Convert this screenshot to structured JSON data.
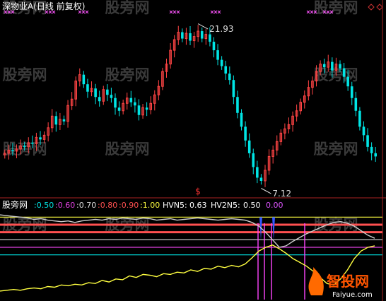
{
  "header": {
    "stock": "深物业A(日线 前复权)",
    "high_label": "21.93",
    "low_label": "7.12",
    "signal_mark": "$"
  },
  "watermarks": [
    "股旁网",
    "股旁网",
    "股旁网",
    "股旁网",
    "股旁网",
    "股旁网",
    "股旁网",
    "股旁网",
    "股旁网",
    "股旁网",
    "股旁网",
    "股旁网"
  ],
  "indicator": {
    "name": "股旁网",
    "levels": [
      {
        "text": "0.50",
        "color": "#00e5e5"
      },
      {
        "text": "0.60",
        "color": "#e040e0"
      },
      {
        "text": "0.70",
        "color": "#dddddd"
      },
      {
        "text": "0.80",
        "color": "#ff5050"
      },
      {
        "text": "0.90",
        "color": "#ff5050"
      },
      {
        "text": "1.00",
        "color": "#ffff40"
      }
    ],
    "hvn5_label": "HVN5:",
    "hvn5_value": "0.63",
    "hv2n5_label": "HV2N5:",
    "hv2n5_value": "0.50",
    "extra_value": "0.00"
  },
  "logo": {
    "text": "智投网",
    "url": "Faiyue.com"
  },
  "chart_data": [
    {
      "type": "candlestick",
      "title": "深物业A(日线 前复权)",
      "y_range": [
        6.5,
        23
      ],
      "annotations": [
        {
          "label": "21.93",
          "kind": "high"
        },
        {
          "label": "7.12",
          "kind": "low"
        }
      ],
      "close_path": [
        9.9,
        10.2,
        10.1,
        10.3,
        10.6,
        10.5,
        10.9,
        10.8,
        11.4,
        11.2,
        11.6,
        12.3,
        13.4,
        12.6,
        13.1,
        12.9,
        14.4,
        15.0,
        16.7,
        17.3,
        16.4,
        15.7,
        16.0,
        15.2,
        14.8,
        15.9,
        15.4,
        15.1,
        14.2,
        13.9,
        14.6,
        15.1,
        14.7,
        14.4,
        13.5,
        14.2,
        14.0,
        14.6,
        15.4,
        16.2,
        17.6,
        18.3,
        19.6,
        20.6,
        21.3,
        20.7,
        21.2,
        20.5,
        20.9,
        21.4,
        20.7,
        21.1,
        20.4,
        19.6,
        18.7,
        18.1,
        17.4,
        16.8,
        15.2,
        13.7,
        12.4,
        11.1,
        9.9,
        8.6,
        7.6,
        7.3,
        8.3,
        9.6,
        10.2,
        11.0,
        11.8,
        12.2,
        12.6,
        13.4,
        13.9,
        14.7,
        15.3,
        16.1,
        16.7,
        17.6,
        18.3,
        18.0,
        18.5,
        17.7,
        18.3,
        17.9,
        17.1,
        16.2,
        15.1,
        13.9,
        12.4,
        11.6,
        10.5,
        9.9,
        9.6
      ]
    },
    {
      "type": "line",
      "title": "股旁网",
      "y_range": [
        0,
        1.05
      ],
      "levels": [
        0.5,
        0.6,
        0.7,
        0.8,
        0.9,
        1.0
      ],
      "series": [
        {
          "name": "HVN5",
          "color": "#ffff40",
          "values": [
            0.02,
            0.03,
            0.04,
            0.03,
            0.05,
            0.06,
            0.05,
            0.08,
            0.07,
            0.1,
            0.09,
            0.11,
            0.1,
            0.13,
            0.12,
            0.16,
            0.14,
            0.18,
            0.17,
            0.22,
            0.2,
            0.24,
            0.23,
            0.21,
            0.25,
            0.24,
            0.27,
            0.26,
            0.3,
            0.28,
            0.32,
            0.31,
            0.35,
            0.33,
            0.36,
            0.34,
            0.38,
            0.46,
            0.55,
            0.6,
            0.63,
            0.58,
            0.52,
            0.45,
            0.4,
            0.35,
            0.28,
            0.2,
            0.12,
            0.1,
            0.18,
            0.3,
            0.45,
            0.55,
            0.6,
            0.62
          ]
        },
        {
          "name": "HV2N5",
          "color": "#cccccc",
          "values": [
            1.03,
            1.02,
            1.01,
            1.0,
            0.99,
            0.97,
            0.98,
            0.96,
            0.95,
            0.94,
            0.95,
            0.93,
            0.95,
            0.96,
            0.97,
            0.96,
            0.98,
            0.97,
            0.99,
            0.98,
            0.97,
            0.99,
            0.98,
            0.96,
            0.97,
            0.98,
            0.96,
            0.97,
            0.98,
            0.99,
            0.98,
            0.97,
            0.96,
            0.97,
            0.98,
            0.97,
            0.96,
            0.93,
            0.88,
            0.8,
            0.7,
            0.6,
            0.62,
            0.68,
            0.73,
            0.78,
            0.82,
            0.86,
            0.9,
            0.93,
            0.94,
            0.92,
            0.88,
            0.82,
            0.76,
            0.72
          ]
        }
      ],
      "spikes": [
        0.68,
        0.7
      ]
    }
  ]
}
